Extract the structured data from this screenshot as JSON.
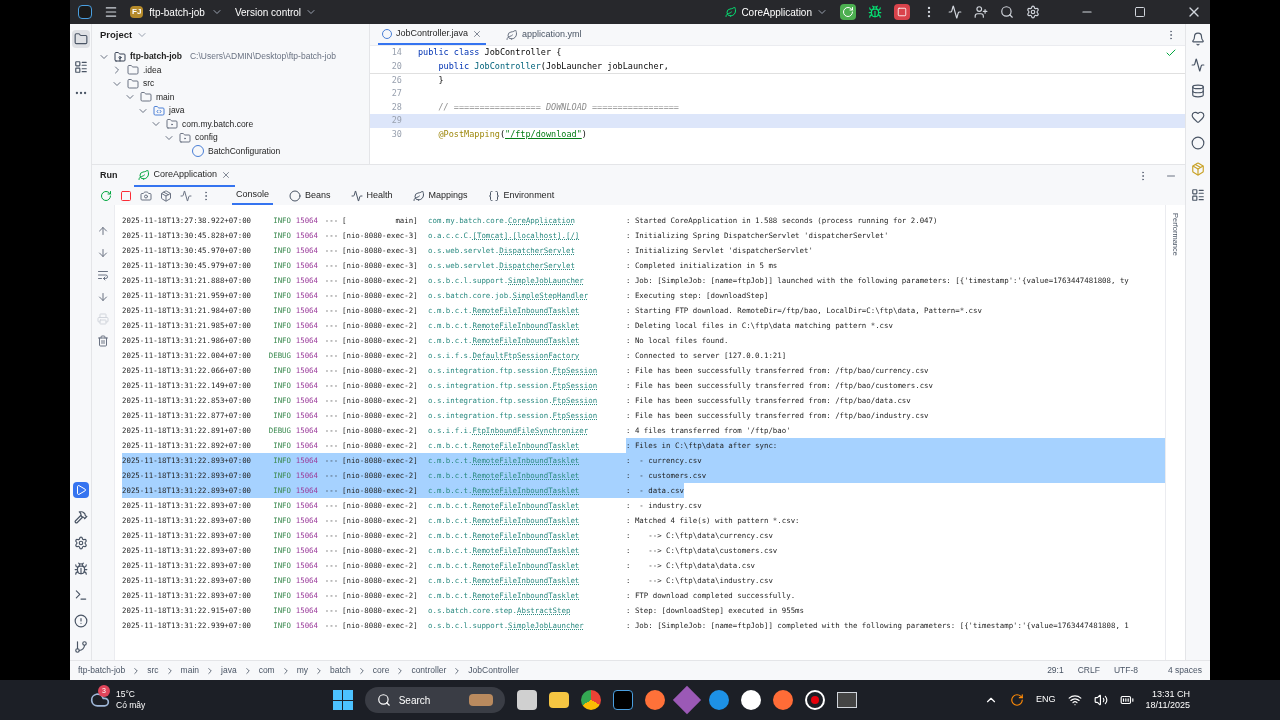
{
  "title_bar": {
    "project_badge": "FJ",
    "project": "ftp-batch-job",
    "vcs": "Version control",
    "run_config": "CoreApplication"
  },
  "project": {
    "title": "Project",
    "tree": [
      {
        "name": "ftp-batch-job",
        "path": "C:\\Users\\ADMIN\\Desktop\\ftp-batch-job",
        "kind": "module",
        "expanded": true,
        "children": [
          {
            "name": ".idea",
            "kind": "folder",
            "expanded": false
          },
          {
            "name": "src",
            "kind": "folder",
            "expanded": true,
            "children": [
              {
                "name": "main",
                "kind": "folder",
                "expanded": true,
                "children": [
                  {
                    "name": "java",
                    "kind": "source",
                    "expanded": true,
                    "children": [
                      {
                        "name": "com.my.batch.core",
                        "kind": "package",
                        "expanded": true,
                        "children": [
                          {
                            "name": "config",
                            "kind": "package",
                            "expanded": true,
                            "children": [
                              {
                                "name": "BatchConfiguration",
                                "kind": "class"
                              }
                            ]
                          }
                        ]
                      }
                    ]
                  }
                ]
              }
            ]
          }
        ]
      }
    ]
  },
  "editor": {
    "tabs": [
      {
        "label": "JobController.java",
        "kind": "java",
        "selected": true
      },
      {
        "label": "application.yml",
        "kind": "yaml",
        "selected": false
      }
    ],
    "lines": [
      {
        "number": "14",
        "current": false,
        "tokens": [
          {
            "text": "public class ",
            "kind": "keyword"
          },
          {
            "text": "JobController {",
            "kind": "plain"
          }
        ]
      },
      {
        "number": "20",
        "current": false,
        "tokens": [
          {
            "text": "    public ",
            "kind": "keyword"
          },
          {
            "text": "JobController",
            "kind": "method"
          },
          {
            "text": "(JobLauncher jobLauncher,",
            "kind": "plain"
          }
        ]
      },
      {
        "number": "26",
        "current": false,
        "tokens": [
          {
            "text": "    }",
            "kind": "plain"
          }
        ]
      },
      {
        "number": "27",
        "current": false
      },
      {
        "number": "28",
        "current": false,
        "tokens": [
          {
            "text": "    // ================= DOWNLOAD =================",
            "kind": "comment"
          }
        ]
      },
      {
        "number": "29",
        "current": true
      },
      {
        "number": "30",
        "current": false,
        "tokens": [
          {
            "text": "    @PostMapping",
            "kind": "annotation"
          },
          {
            "text": "(",
            "kind": "plain"
          },
          {
            "text": "\"/ftp/download\"",
            "kind": "string"
          },
          {
            "text": ")",
            "kind": "plain"
          }
        ]
      }
    ]
  },
  "run": {
    "title": "Run",
    "tab": "CoreApplication",
    "side_label": "Performance",
    "subtabs": [
      {
        "label": "Console",
        "kind": "console",
        "selected": true
      },
      {
        "label": "Beans",
        "kind": "beans",
        "selected": false
      },
      {
        "label": "Health",
        "kind": "health",
        "selected": false
      },
      {
        "label": "Mappings",
        "kind": "mappings",
        "selected": false
      },
      {
        "label": "Environment",
        "kind": "environment",
        "selected": false
      }
    ],
    "rows": [
      {
        "time": "2025-11-18T13:27:38.922+07:00",
        "level": "INFO",
        "pid": "15064",
        "sep": "---",
        "thread": "[           main]",
        "pkg": "com.my.batch.core.",
        "cls": "CoreApplication",
        "msg": ": Started CoreApplication in 1.588 seconds (process running for 2.047)",
        "prefix_selected": false,
        "message_selected": false,
        "line_end_selected": false
      },
      {
        "time": "2025-11-18T13:30:45.828+07:00",
        "level": "INFO",
        "pid": "15064",
        "sep": "---",
        "thread": "[nio-8080-exec-3]",
        "pkg": "o.a.c.c.C.",
        "cls": "[Tomcat].[localhost].[/]",
        "msg": ": Initializing Spring DispatcherServlet 'dispatcherServlet'",
        "prefix_selected": false,
        "message_selected": false,
        "line_end_selected": false
      },
      {
        "time": "2025-11-18T13:30:45.970+07:00",
        "level": "INFO",
        "pid": "15064",
        "sep": "---",
        "thread": "[nio-8080-exec-3]",
        "pkg": "o.s.web.servlet.",
        "cls": "DispatcherServlet",
        "msg": ": Initializing Servlet 'dispatcherServlet'",
        "prefix_selected": false,
        "message_selected": false,
        "line_end_selected": false
      },
      {
        "time": "2025-11-18T13:30:45.979+07:00",
        "level": "INFO",
        "pid": "15064",
        "sep": "---",
        "thread": "[nio-8080-exec-3]",
        "pkg": "o.s.web.servlet.",
        "cls": "DispatcherServlet",
        "msg": ": Completed initialization in 5 ms",
        "prefix_selected": false,
        "message_selected": false,
        "line_end_selected": false
      },
      {
        "time": "2025-11-18T13:31:21.888+07:00",
        "level": "INFO",
        "pid": "15064",
        "sep": "---",
        "thread": "[nio-8080-exec-2]",
        "pkg": "o.s.b.c.l.support.",
        "cls": "SimpleJobLauncher",
        "msg": ": Job: [SimpleJob: [name=ftpJob]] launched with the following parameters: [{'timestamp':'{value=1763447481808, ty",
        "prefix_selected": false,
        "message_selected": false,
        "line_end_selected": false
      },
      {
        "time": "2025-11-18T13:31:21.959+07:00",
        "level": "INFO",
        "pid": "15064",
        "sep": "---",
        "thread": "[nio-8080-exec-2]",
        "pkg": "o.s.batch.core.job.",
        "cls": "SimpleStepHandler",
        "msg": ": Executing step: [downloadStep]",
        "prefix_selected": false,
        "message_selected": false,
        "line_end_selected": false
      },
      {
        "time": "2025-11-18T13:31:21.984+07:00",
        "level": "INFO",
        "pid": "15064",
        "sep": "---",
        "thread": "[nio-8080-exec-2]",
        "pkg": "c.m.b.c.t.",
        "cls": "RemoteFileInboundTasklet",
        "msg": ": Starting FTP download. RemoteDir=/ftp/bao, LocalDir=C:\\ftp\\data, Pattern=*.csv",
        "prefix_selected": false,
        "message_selected": false,
        "line_end_selected": false
      },
      {
        "time": "2025-11-18T13:31:21.985+07:00",
        "level": "INFO",
        "pid": "15064",
        "sep": "---",
        "thread": "[nio-8080-exec-2]",
        "pkg": "c.m.b.c.t.",
        "cls": "RemoteFileInboundTasklet",
        "msg": ": Deleting local files in C:\\ftp\\data matching pattern *.csv",
        "prefix_selected": false,
        "message_selected": false,
        "line_end_selected": false
      },
      {
        "time": "2025-11-18T13:31:21.986+07:00",
        "level": "INFO",
        "pid": "15064",
        "sep": "---",
        "thread": "[nio-8080-exec-2]",
        "pkg": "c.m.b.c.t.",
        "cls": "RemoteFileInboundTasklet",
        "msg": ": No local files found.",
        "prefix_selected": false,
        "message_selected": false,
        "line_end_selected": false
      },
      {
        "time": "2025-11-18T13:31:22.004+07:00",
        "level": "DEBUG",
        "pid": "15064",
        "sep": "---",
        "thread": "[nio-8080-exec-2]",
        "pkg": "o.s.i.f.s.",
        "cls": "DefaultFtpSessionFactory",
        "msg": ": Connected to server [127.0.0.1:21]",
        "prefix_selected": false,
        "message_selected": false,
        "line_end_selected": false
      },
      {
        "time": "2025-11-18T13:31:22.066+07:00",
        "level": "INFO",
        "pid": "15064",
        "sep": "---",
        "thread": "[nio-8080-exec-2]",
        "pkg": "o.s.integration.ftp.session.",
        "cls": "FtpSession",
        "msg": ": File has been successfully transferred from: /ftp/bao/currency.csv",
        "prefix_selected": false,
        "message_selected": false,
        "line_end_selected": false
      },
      {
        "time": "2025-11-18T13:31:22.149+07:00",
        "level": "INFO",
        "pid": "15064",
        "sep": "---",
        "thread": "[nio-8080-exec-2]",
        "pkg": "o.s.integration.ftp.session.",
        "cls": "FtpSession",
        "msg": ": File has been successfully transferred from: /ftp/bao/customers.csv",
        "prefix_selected": false,
        "message_selected": false,
        "line_end_selected": false
      },
      {
        "time": "2025-11-18T13:31:22.853+07:00",
        "level": "INFO",
        "pid": "15064",
        "sep": "---",
        "thread": "[nio-8080-exec-2]",
        "pkg": "o.s.integration.ftp.session.",
        "cls": "FtpSession",
        "msg": ": File has been successfully transferred from: /ftp/bao/data.csv",
        "prefix_selected": false,
        "message_selected": false,
        "line_end_selected": false
      },
      {
        "time": "2025-11-18T13:31:22.877+07:00",
        "level": "INFO",
        "pid": "15064",
        "sep": "---",
        "thread": "[nio-8080-exec-2]",
        "pkg": "o.s.integration.ftp.session.",
        "cls": "FtpSession",
        "msg": ": File has been successfully transferred from: /ftp/bao/industry.csv",
        "prefix_selected": false,
        "message_selected": false,
        "line_end_selected": false
      },
      {
        "time": "2025-11-18T13:31:22.891+07:00",
        "level": "DEBUG",
        "pid": "15064",
        "sep": "---",
        "thread": "[nio-8080-exec-2]",
        "pkg": "o.s.i.f.i.",
        "cls": "FtpInboundFileSynchronizer",
        "msg": ": 4 files transferred from '/ftp/bao'",
        "prefix_selected": false,
        "message_selected": false,
        "line_end_selected": false
      },
      {
        "time": "2025-11-18T13:31:22.892+07:00",
        "level": "INFO",
        "pid": "15064",
        "sep": "---",
        "thread": "[nio-8080-exec-2]",
        "pkg": "c.m.b.c.t.",
        "cls": "RemoteFileInboundTasklet",
        "msg": ": Files in C:\\ftp\\data after sync:",
        "prefix_selected": false,
        "message_selected": true,
        "line_end_selected": true
      },
      {
        "time": "2025-11-18T13:31:22.893+07:00",
        "level": "INFO",
        "pid": "15064",
        "sep": "---",
        "thread": "[nio-8080-exec-2]",
        "pkg": "c.m.b.c.t.",
        "cls": "RemoteFileInboundTasklet",
        "msg": ":  - currency.csv",
        "prefix_selected": true,
        "message_selected": true,
        "line_end_selected": true
      },
      {
        "time": "2025-11-18T13:31:22.893+07:00",
        "level": "INFO",
        "pid": "15064",
        "sep": "---",
        "thread": "[nio-8080-exec-2]",
        "pkg": "c.m.b.c.t.",
        "cls": "RemoteFileInboundTasklet",
        "msg": ":  - customers.csv",
        "prefix_selected": true,
        "message_selected": true,
        "line_end_selected": true
      },
      {
        "time": "2025-11-18T13:31:22.893+07:00",
        "level": "INFO",
        "pid": "15064",
        "sep": "---",
        "thread": "[nio-8080-exec-2]",
        "pkg": "c.m.b.c.t.",
        "cls": "RemoteFileInboundTasklet",
        "msg": ":  - data.csv",
        "prefix_selected": true,
        "message_selected": true,
        "line_end_selected": false
      },
      {
        "time": "2025-11-18T13:31:22.893+07:00",
        "level": "INFO",
        "pid": "15064",
        "sep": "---",
        "thread": "[nio-8080-exec-2]",
        "pkg": "c.m.b.c.t.",
        "cls": "RemoteFileInboundTasklet",
        "msg": ":  - industry.csv",
        "prefix_selected": false,
        "message_selected": false,
        "line_end_selected": false
      },
      {
        "time": "2025-11-18T13:31:22.893+07:00",
        "level": "INFO",
        "pid": "15064",
        "sep": "---",
        "thread": "[nio-8080-exec-2]",
        "pkg": "c.m.b.c.t.",
        "cls": "RemoteFileInboundTasklet",
        "msg": ": Matched 4 file(s) with pattern *.csv:",
        "prefix_selected": false,
        "message_selected": false,
        "line_end_selected": false
      },
      {
        "time": "2025-11-18T13:31:22.893+07:00",
        "level": "INFO",
        "pid": "15064",
        "sep": "---",
        "thread": "[nio-8080-exec-2]",
        "pkg": "c.m.b.c.t.",
        "cls": "RemoteFileInboundTasklet",
        "msg": ":    --> C:\\ftp\\data\\currency.csv",
        "prefix_selected": false,
        "message_selected": false,
        "line_end_selected": false
      },
      {
        "time": "2025-11-18T13:31:22.893+07:00",
        "level": "INFO",
        "pid": "15064",
        "sep": "---",
        "thread": "[nio-8080-exec-2]",
        "pkg": "c.m.b.c.t.",
        "cls": "RemoteFileInboundTasklet",
        "msg": ":    --> C:\\ftp\\data\\customers.csv",
        "prefix_selected": false,
        "message_selected": false,
        "line_end_selected": false
      },
      {
        "time": "2025-11-18T13:31:22.893+07:00",
        "level": "INFO",
        "pid": "15064",
        "sep": "---",
        "thread": "[nio-8080-exec-2]",
        "pkg": "c.m.b.c.t.",
        "cls": "RemoteFileInboundTasklet",
        "msg": ":    --> C:\\ftp\\data\\data.csv",
        "prefix_selected": false,
        "message_selected": false,
        "line_end_selected": false
      },
      {
        "time": "2025-11-18T13:31:22.893+07:00",
        "level": "INFO",
        "pid": "15064",
        "sep": "---",
        "thread": "[nio-8080-exec-2]",
        "pkg": "c.m.b.c.t.",
        "cls": "RemoteFileInboundTasklet",
        "msg": ":    --> C:\\ftp\\data\\industry.csv",
        "prefix_selected": false,
        "message_selected": false,
        "line_end_selected": false
      },
      {
        "time": "2025-11-18T13:31:22.893+07:00",
        "level": "INFO",
        "pid": "15064",
        "sep": "---",
        "thread": "[nio-8080-exec-2]",
        "pkg": "c.m.b.c.t.",
        "cls": "RemoteFileInboundTasklet",
        "msg": ": FTP download completed successfully.",
        "prefix_selected": false,
        "message_selected": false,
        "line_end_selected": false
      },
      {
        "time": "2025-11-18T13:31:22.915+07:00",
        "level": "INFO",
        "pid": "15064",
        "sep": "---",
        "thread": "[nio-8080-exec-2]",
        "pkg": "o.s.batch.core.step.",
        "cls": "AbstractStep",
        "msg": ": Step: [downloadStep] executed in 955ms",
        "prefix_selected": false,
        "message_selected": false,
        "line_end_selected": false
      },
      {
        "time": "2025-11-18T13:31:22.939+07:00",
        "level": "INFO",
        "pid": "15064",
        "sep": "---",
        "thread": "[nio-8080-exec-2]",
        "pkg": "o.s.b.c.l.support.",
        "cls": "SimpleJobLauncher",
        "msg": ": Job: [SimpleJob: [name=ftpJob]] completed with the following parameters: [{'timestamp':'{value=1763447481808, 1",
        "prefix_selected": false,
        "message_selected": false,
        "line_end_selected": false
      }
    ]
  },
  "status_bar": {
    "breadcrumbs": [
      "ftp-batch-job",
      "src",
      "main",
      "java",
      "com",
      "my",
      "batch",
      "core",
      "controller",
      "JobController"
    ],
    "position": "29:1",
    "line_ending": "CRLF",
    "encoding": "UTF-8",
    "indent": "4 spaces"
  },
  "taskbar": {
    "weather_badge": "3",
    "temperature": "15°C",
    "weather": "Có mây",
    "search": "Search",
    "language": "ENG",
    "time": "13:31 CH",
    "date": "18/11/2025"
  }
}
